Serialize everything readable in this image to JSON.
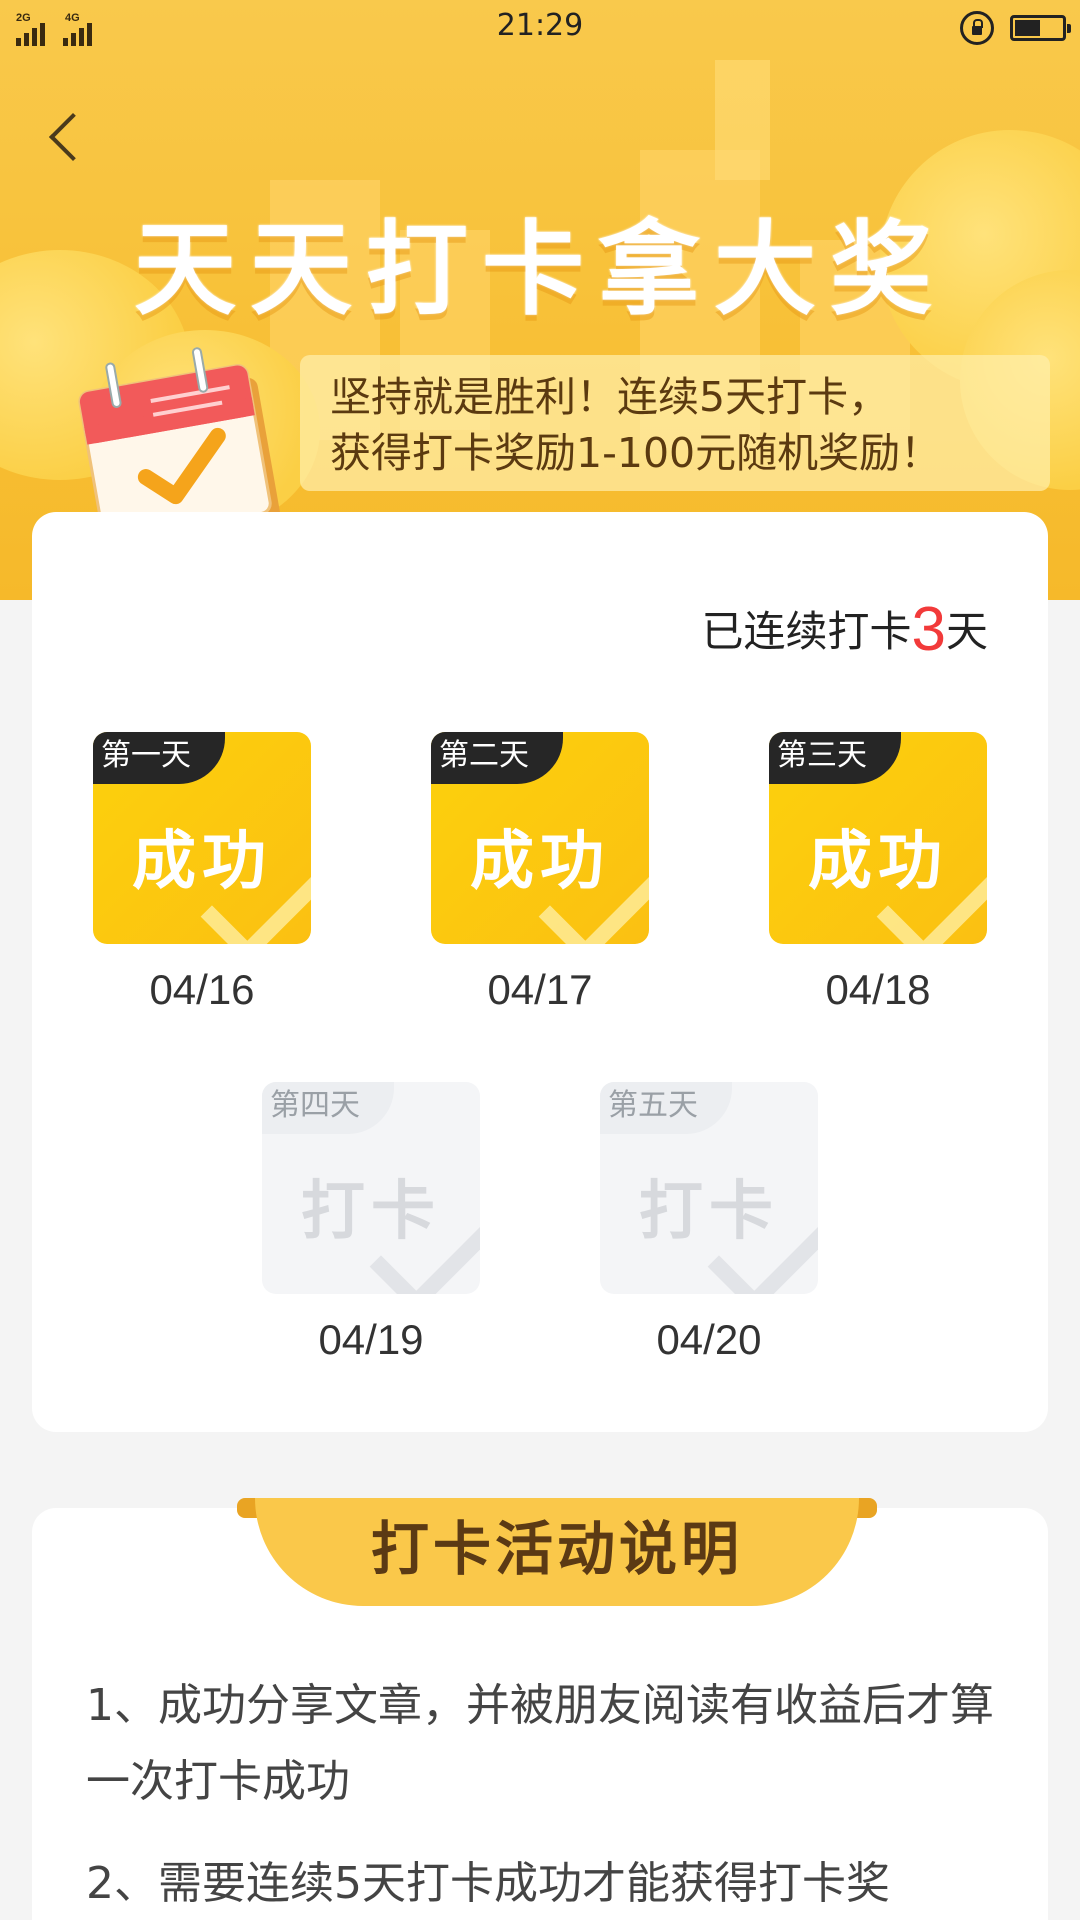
{
  "status_bar": {
    "time": "21:29",
    "network_1": "2G",
    "network_2": "4G",
    "icons": [
      "signal-icon",
      "signal-icon",
      "rotation-lock-icon",
      "battery-icon"
    ]
  },
  "header": {
    "back_icon": "chevron-left-icon",
    "title": "天天打卡拿大奖",
    "tip_line_1": "坚持就是胜利！连续5天打卡，",
    "tip_line_2": "获得打卡奖励1-100元随机奖励！",
    "illustration": "calendar-check-icon"
  },
  "checkin": {
    "streak_prefix": "已连续打卡",
    "streak_days": "3",
    "streak_suffix": "天",
    "days": [
      {
        "tag": "第一天",
        "status": "成功",
        "date": "04/16",
        "done": true
      },
      {
        "tag": "第二天",
        "status": "成功",
        "date": "04/17",
        "done": true
      },
      {
        "tag": "第三天",
        "status": "成功",
        "date": "04/18",
        "done": true
      },
      {
        "tag": "第四天",
        "status": "打卡",
        "date": "04/19",
        "done": false
      },
      {
        "tag": "第五天",
        "status": "打卡",
        "date": "04/20",
        "done": false
      }
    ]
  },
  "rules": {
    "title": "打卡活动说明",
    "items": [
      "1、成功分享文章，并被朋友阅读有收益后才算一次打卡成功",
      "2、需要连续5天打卡成功才能获得打卡奖"
    ]
  },
  "colors": {
    "banner_yellow": "#f8c23a",
    "success_tile": "#fcd10c",
    "streak_red": "#f23a3a",
    "rules_pill": "#fac84a"
  }
}
